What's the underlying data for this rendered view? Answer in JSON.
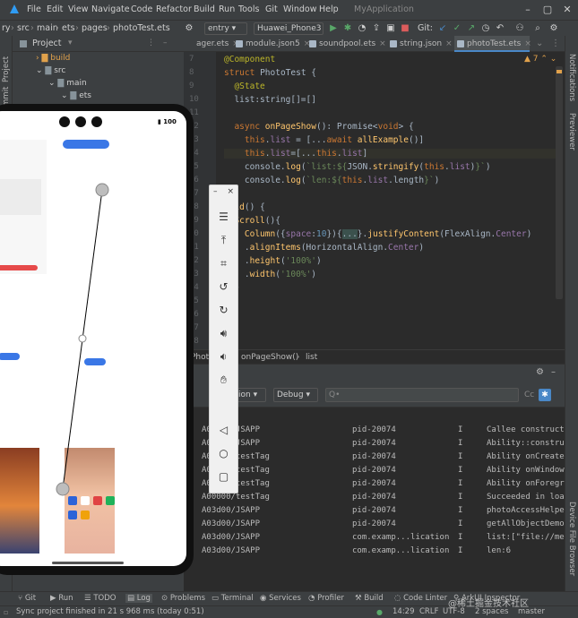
{
  "menubar": {
    "items": [
      "File",
      "Edit",
      "View",
      "Navigate",
      "Code",
      "Refactor",
      "Build",
      "Run",
      "Tools",
      "Git",
      "Window",
      "Help"
    ],
    "app_title": "MyApplication"
  },
  "navbar": {
    "crumbs": [
      "ry",
      "src",
      "main",
      "ets",
      "pages",
      "photoTest.ets"
    ],
    "run_config": "entry",
    "device": "Huawei_Phone3",
    "git_label": "Git:"
  },
  "tabs": [
    {
      "label": "ager.ets",
      "active": false
    },
    {
      "label": "module.json5",
      "active": false
    },
    {
      "label": "soundpool.ets",
      "active": false
    },
    {
      "label": "string.json",
      "active": false
    },
    {
      "label": "photoTest.ets",
      "active": true
    }
  ],
  "project": {
    "title": "Project",
    "tree": [
      {
        "label": "build",
        "indent": 0
      },
      {
        "label": "src",
        "indent": 0
      },
      {
        "label": "main",
        "indent": 1
      },
      {
        "label": "ets",
        "indent": 2
      }
    ],
    "strip_labels": [
      "Project",
      "Commit"
    ]
  },
  "editor": {
    "line_numbers": [
      "7",
      "8",
      "9",
      "10",
      "11",
      "12",
      "13",
      "14",
      "15",
      "16",
      "17",
      "18",
      "19",
      "20",
      "21",
      "22",
      "23",
      "24",
      "25",
      "26",
      "27",
      "28",
      "29",
      "30",
      "31",
      "32"
    ],
    "warning_count": "7",
    "lines": [
      "@Component",
      "struct PhotoTest {",
      "  @State",
      "  list:string[]=[]",
      "",
      "  async onPageShow(): Promise<void> {",
      "    this.list = [...await allExample()]",
      "    this.list=[...this.list]",
      "    console.log(`list:${JSON.stringify(this.list)}`)",
      "    console.log(`len:${this.list.length}`)",
      "",
      "uild() {",
      "  Scroll(){",
      "    Column({space:10}){...}.justifyContent(FlexAlign.Center)",
      "    .alignItems(HorizontalAlign.Center)",
      "    .height('100%')",
      "    .width('100%')",
      "  }"
    ]
  },
  "breadcrumb": {
    "items": [
      "Photo",
      "onPageShow()",
      "list"
    ]
  },
  "log": {
    "filter_label": "ation",
    "level": "Debug",
    "search_placeholder": "Q•",
    "cc_label": "Cc",
    "rows": [
      {
        "tag": "A03d00/JSAPP",
        "pid": "pid-20074",
        "lvl": "I",
        "msg": "Callee construct"
      },
      {
        "tag": "A03d00/JSAPP",
        "pid": "pid-20074",
        "lvl": "I",
        "msg": "Ability::constru"
      },
      {
        "tag": "A00000/testTag",
        "pid": "pid-20074",
        "lvl": "I",
        "msg": "Ability onCreate"
      },
      {
        "tag": "A00000/testTag",
        "pid": "pid-20074",
        "lvl": "I",
        "msg": "Ability onWindow"
      },
      {
        "tag": "A00000/testTag",
        "pid": "pid-20074",
        "lvl": "I",
        "msg": "Ability onForegr"
      },
      {
        "tag": "A00000/testTag",
        "pid": "pid-20074",
        "lvl": "I",
        "msg": "Succeeded in loa"
      },
      {
        "tag": "A03d00/JSAPP",
        "pid": "pid-20074",
        "lvl": "I",
        "msg": "photoAccessHelpe"
      },
      {
        "tag": "A03d00/JSAPP",
        "pid": "pid-20074",
        "lvl": "I",
        "msg": "getAllObjectDemo"
      },
      {
        "tag": "A03d00/JSAPP",
        "pid": "com.examp...lication",
        "lvl": "I",
        "msg": "list:[\"file://me"
      },
      {
        "tag": "A03d00/JSAPP",
        "pid": "com.examp...lication",
        "lvl": "I",
        "msg": "len:6"
      }
    ]
  },
  "right_strip": [
    "Notifications",
    "Previewer",
    "Device File Browser"
  ],
  "bottom_tools": [
    "Git",
    "Run",
    "TODO",
    "Log",
    "Problems",
    "Terminal",
    "Services",
    "Profiler",
    "Build",
    "Code Linter",
    "ArkUI Inspector"
  ],
  "status": {
    "message": "Sync project finished in 21 s 968 ms (today 0:51)",
    "position": "14:29",
    "line_sep": "CRLF",
    "encoding": "UTF-8",
    "indent": "2 spaces",
    "branch": "master",
    "watermark": "@稀土掘金技术社区"
  },
  "emulator": {
    "battery": "100",
    "toolbar_icons": [
      "minimize-icon",
      "close-icon",
      "menu-icon",
      "pin-top-icon",
      "crop-icon",
      "rotate-left-icon",
      "rotate-right-icon",
      "volume-up-icon",
      "volume-down-icon",
      "gesture-icon",
      "back-icon",
      "home-icon",
      "recents-icon"
    ]
  },
  "colors": {
    "accent": "#4a88c7",
    "keyword": "#cc7832",
    "decorator": "#bbb529",
    "string": "#6a8759"
  }
}
